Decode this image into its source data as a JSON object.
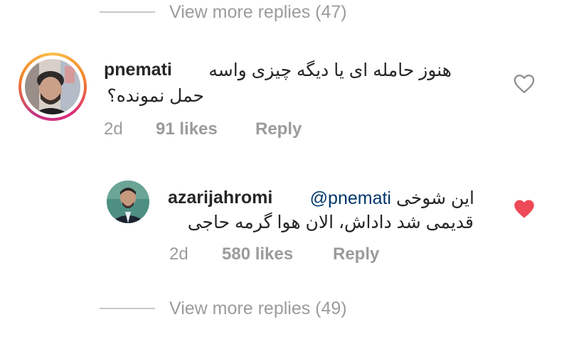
{
  "top_more": {
    "label": "View more replies (47)"
  },
  "comment": {
    "username": "pnemati",
    "line1": "هنوز حامله ای یا دیگه چیزی واسه",
    "line2": "حمل نمونده؟",
    "time": "2d",
    "likes": "91 likes",
    "reply": "Reply",
    "liked": false,
    "like_icon": "heart-outline-icon"
  },
  "reply": {
    "username": "azarijahromi",
    "mention": "@pnemati",
    "line1_text": "این شوخی",
    "line2": "قدیمی شد داداش، الان هوا گرمه حاجی",
    "time": "2d",
    "likes": "580 likes",
    "reply": "Reply",
    "liked": true,
    "like_icon": "heart-filled-icon",
    "like_color": "#ed4956"
  },
  "bottom_more": {
    "label": "View more replies (49)"
  }
}
